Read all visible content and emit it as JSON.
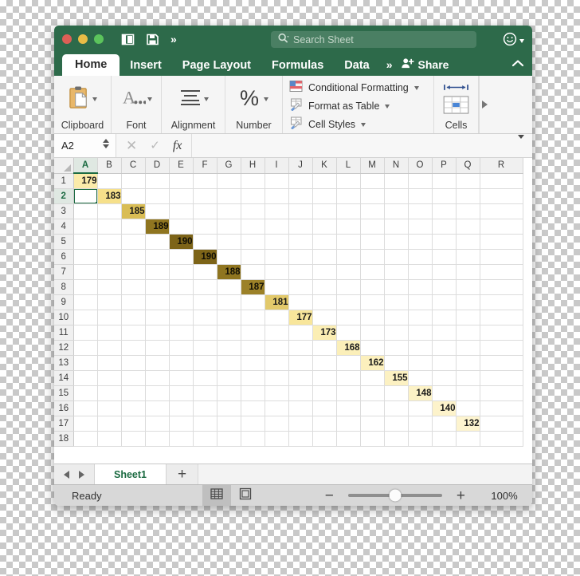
{
  "window": {
    "traffic_lights": [
      "close",
      "minimize",
      "maximize"
    ],
    "quick_access": [
      "sidebar-icon",
      "save-icon",
      "overflow-chevrons"
    ],
    "search": {
      "placeholder": "Search Sheet",
      "value": ""
    },
    "account_icon": "smiley-icon"
  },
  "tabs": {
    "items": [
      {
        "label": "Home",
        "active": true
      },
      {
        "label": "Insert",
        "active": false
      },
      {
        "label": "Page Layout",
        "active": false
      },
      {
        "label": "Formulas",
        "active": false
      },
      {
        "label": "Data",
        "active": false
      }
    ],
    "overflow": "»",
    "share_label": "Share",
    "collapse_icon": "chevron-up-icon"
  },
  "ribbon": {
    "groups": [
      {
        "label": "Clipboard",
        "icon": "clipboard-icon"
      },
      {
        "label": "Font",
        "icon": "font-a-icon"
      },
      {
        "label": "Alignment",
        "icon": "alignment-icon"
      },
      {
        "label": "Number",
        "icon": "percent-icon"
      },
      {
        "label": "Cells",
        "icon": "cells-icon"
      }
    ],
    "styles": [
      {
        "label": "Conditional Formatting",
        "icon": "conditional-formatting-icon"
      },
      {
        "label": "Format as Table",
        "icon": "format-as-table-icon"
      },
      {
        "label": "Cell Styles",
        "icon": "cell-styles-icon"
      }
    ]
  },
  "formula_bar": {
    "name_box": "A2",
    "cancel_icon": "x-icon",
    "confirm_icon": "check-icon",
    "function_icon": "fx-icon",
    "formula_value": "",
    "expand_icon": "chevron-down-icon"
  },
  "grid": {
    "columns": [
      "A",
      "B",
      "C",
      "D",
      "E",
      "F",
      "G",
      "H",
      "I",
      "J",
      "K",
      "L",
      "M",
      "N",
      "O",
      "P",
      "Q",
      "R"
    ],
    "rows": [
      1,
      2,
      3,
      4,
      5,
      6,
      7,
      8,
      9,
      10,
      11,
      12,
      13,
      14,
      15,
      16,
      17,
      18
    ],
    "selected_cell": "A2",
    "selected_column": "A",
    "selected_row": 2,
    "filled_cells": [
      {
        "col": "A",
        "row": 1,
        "value": "179",
        "bg": "#fbebaa",
        "fg": "#1a1a1a"
      },
      {
        "col": "B",
        "row": 2,
        "value": "183",
        "bg": "#f6e08a",
        "fg": "#1a1a1a"
      },
      {
        "col": "C",
        "row": 3,
        "value": "185",
        "bg": "#d9bd55",
        "fg": "#1a1a1a"
      },
      {
        "col": "D",
        "row": 4,
        "value": "189",
        "bg": "#8f7520",
        "fg": "#100e05"
      },
      {
        "col": "E",
        "row": 5,
        "value": "190",
        "bg": "#7d6418",
        "fg": "#100e05"
      },
      {
        "col": "F",
        "row": 6,
        "value": "190",
        "bg": "#7d6418",
        "fg": "#100e05"
      },
      {
        "col": "G",
        "row": 7,
        "value": "188",
        "bg": "#8f7520",
        "fg": "#100e05"
      },
      {
        "col": "H",
        "row": 8,
        "value": "187",
        "bg": "#9c8128",
        "fg": "#100e05"
      },
      {
        "col": "I",
        "row": 9,
        "value": "181",
        "bg": "#e2c96b",
        "fg": "#1a1a1a"
      },
      {
        "col": "J",
        "row": 10,
        "value": "177",
        "bg": "#f8e69b",
        "fg": "#1a1a1a"
      },
      {
        "col": "K",
        "row": 11,
        "value": "173",
        "bg": "#fbeeb4",
        "fg": "#1a1a1a"
      },
      {
        "col": "L",
        "row": 12,
        "value": "168",
        "bg": "#fbefb9",
        "fg": "#1a1a1a"
      },
      {
        "col": "M",
        "row": 13,
        "value": "162",
        "bg": "#fcf0bd",
        "fg": "#1a1a1a"
      },
      {
        "col": "N",
        "row": 14,
        "value": "155",
        "bg": "#fcf1c2",
        "fg": "#1a1a1a"
      },
      {
        "col": "O",
        "row": 15,
        "value": "148",
        "bg": "#fcf2c6",
        "fg": "#1a1a1a"
      },
      {
        "col": "P",
        "row": 16,
        "value": "140",
        "bg": "#fdf3cb",
        "fg": "#1a1a1a"
      },
      {
        "col": "Q",
        "row": 17,
        "value": "132",
        "bg": "#fdf4cf",
        "fg": "#1a1a1a"
      }
    ]
  },
  "sheet_tabs": {
    "prev_icon": "nav-left-icon",
    "next_icon": "nav-right-icon",
    "sheets": [
      "Sheet1"
    ],
    "add_label": "+"
  },
  "status_bar": {
    "status": "Ready",
    "view_normal_icon": "grid-view-icon",
    "view_layout_icon": "page-layout-view-icon",
    "zoom_out": "−",
    "zoom_in": "+",
    "zoom_level": "100%"
  },
  "chart_data": {
    "type": "bar",
    "title": "",
    "categories": [
      "A1",
      "B2",
      "C3",
      "D4",
      "E5",
      "F6",
      "G7",
      "H8",
      "I9",
      "J10",
      "K11",
      "L12",
      "M13",
      "N14",
      "O15",
      "P16",
      "Q17"
    ],
    "values": [
      179,
      183,
      185,
      189,
      190,
      190,
      188,
      187,
      181,
      177,
      173,
      168,
      162,
      155,
      148,
      140,
      132
    ],
    "xlabel": "",
    "ylabel": "",
    "ylim": [
      130,
      190
    ]
  }
}
